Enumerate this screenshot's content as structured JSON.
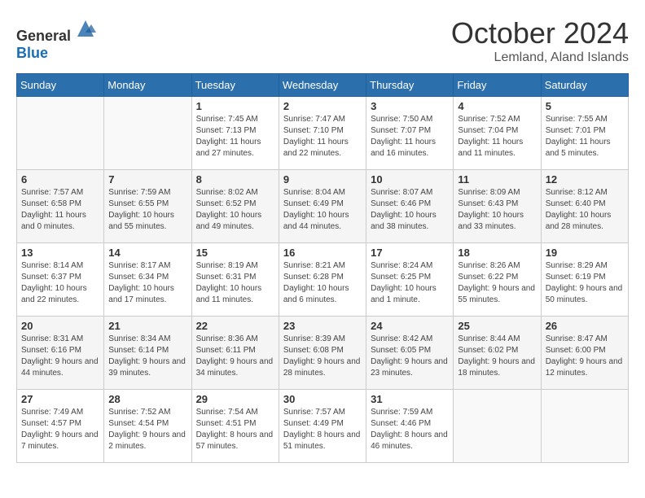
{
  "header": {
    "logo_general": "General",
    "logo_blue": "Blue",
    "month": "October 2024",
    "location": "Lemland, Aland Islands"
  },
  "days_of_week": [
    "Sunday",
    "Monday",
    "Tuesday",
    "Wednesday",
    "Thursday",
    "Friday",
    "Saturday"
  ],
  "weeks": [
    [
      {
        "day": "",
        "info": ""
      },
      {
        "day": "",
        "info": ""
      },
      {
        "day": "1",
        "info": "Sunrise: 7:45 AM\nSunset: 7:13 PM\nDaylight: 11 hours and 27 minutes."
      },
      {
        "day": "2",
        "info": "Sunrise: 7:47 AM\nSunset: 7:10 PM\nDaylight: 11 hours and 22 minutes."
      },
      {
        "day": "3",
        "info": "Sunrise: 7:50 AM\nSunset: 7:07 PM\nDaylight: 11 hours and 16 minutes."
      },
      {
        "day": "4",
        "info": "Sunrise: 7:52 AM\nSunset: 7:04 PM\nDaylight: 11 hours and 11 minutes."
      },
      {
        "day": "5",
        "info": "Sunrise: 7:55 AM\nSunset: 7:01 PM\nDaylight: 11 hours and 5 minutes."
      }
    ],
    [
      {
        "day": "6",
        "info": "Sunrise: 7:57 AM\nSunset: 6:58 PM\nDaylight: 11 hours and 0 minutes."
      },
      {
        "day": "7",
        "info": "Sunrise: 7:59 AM\nSunset: 6:55 PM\nDaylight: 10 hours and 55 minutes."
      },
      {
        "day": "8",
        "info": "Sunrise: 8:02 AM\nSunset: 6:52 PM\nDaylight: 10 hours and 49 minutes."
      },
      {
        "day": "9",
        "info": "Sunrise: 8:04 AM\nSunset: 6:49 PM\nDaylight: 10 hours and 44 minutes."
      },
      {
        "day": "10",
        "info": "Sunrise: 8:07 AM\nSunset: 6:46 PM\nDaylight: 10 hours and 38 minutes."
      },
      {
        "day": "11",
        "info": "Sunrise: 8:09 AM\nSunset: 6:43 PM\nDaylight: 10 hours and 33 minutes."
      },
      {
        "day": "12",
        "info": "Sunrise: 8:12 AM\nSunset: 6:40 PM\nDaylight: 10 hours and 28 minutes."
      }
    ],
    [
      {
        "day": "13",
        "info": "Sunrise: 8:14 AM\nSunset: 6:37 PM\nDaylight: 10 hours and 22 minutes."
      },
      {
        "day": "14",
        "info": "Sunrise: 8:17 AM\nSunset: 6:34 PM\nDaylight: 10 hours and 17 minutes."
      },
      {
        "day": "15",
        "info": "Sunrise: 8:19 AM\nSunset: 6:31 PM\nDaylight: 10 hours and 11 minutes."
      },
      {
        "day": "16",
        "info": "Sunrise: 8:21 AM\nSunset: 6:28 PM\nDaylight: 10 hours and 6 minutes."
      },
      {
        "day": "17",
        "info": "Sunrise: 8:24 AM\nSunset: 6:25 PM\nDaylight: 10 hours and 1 minute."
      },
      {
        "day": "18",
        "info": "Sunrise: 8:26 AM\nSunset: 6:22 PM\nDaylight: 9 hours and 55 minutes."
      },
      {
        "day": "19",
        "info": "Sunrise: 8:29 AM\nSunset: 6:19 PM\nDaylight: 9 hours and 50 minutes."
      }
    ],
    [
      {
        "day": "20",
        "info": "Sunrise: 8:31 AM\nSunset: 6:16 PM\nDaylight: 9 hours and 44 minutes."
      },
      {
        "day": "21",
        "info": "Sunrise: 8:34 AM\nSunset: 6:14 PM\nDaylight: 9 hours and 39 minutes."
      },
      {
        "day": "22",
        "info": "Sunrise: 8:36 AM\nSunset: 6:11 PM\nDaylight: 9 hours and 34 minutes."
      },
      {
        "day": "23",
        "info": "Sunrise: 8:39 AM\nSunset: 6:08 PM\nDaylight: 9 hours and 28 minutes."
      },
      {
        "day": "24",
        "info": "Sunrise: 8:42 AM\nSunset: 6:05 PM\nDaylight: 9 hours and 23 minutes."
      },
      {
        "day": "25",
        "info": "Sunrise: 8:44 AM\nSunset: 6:02 PM\nDaylight: 9 hours and 18 minutes."
      },
      {
        "day": "26",
        "info": "Sunrise: 8:47 AM\nSunset: 6:00 PM\nDaylight: 9 hours and 12 minutes."
      }
    ],
    [
      {
        "day": "27",
        "info": "Sunrise: 7:49 AM\nSunset: 4:57 PM\nDaylight: 9 hours and 7 minutes."
      },
      {
        "day": "28",
        "info": "Sunrise: 7:52 AM\nSunset: 4:54 PM\nDaylight: 9 hours and 2 minutes."
      },
      {
        "day": "29",
        "info": "Sunrise: 7:54 AM\nSunset: 4:51 PM\nDaylight: 8 hours and 57 minutes."
      },
      {
        "day": "30",
        "info": "Sunrise: 7:57 AM\nSunset: 4:49 PM\nDaylight: 8 hours and 51 minutes."
      },
      {
        "day": "31",
        "info": "Sunrise: 7:59 AM\nSunset: 4:46 PM\nDaylight: 8 hours and 46 minutes."
      },
      {
        "day": "",
        "info": ""
      },
      {
        "day": "",
        "info": ""
      }
    ]
  ]
}
